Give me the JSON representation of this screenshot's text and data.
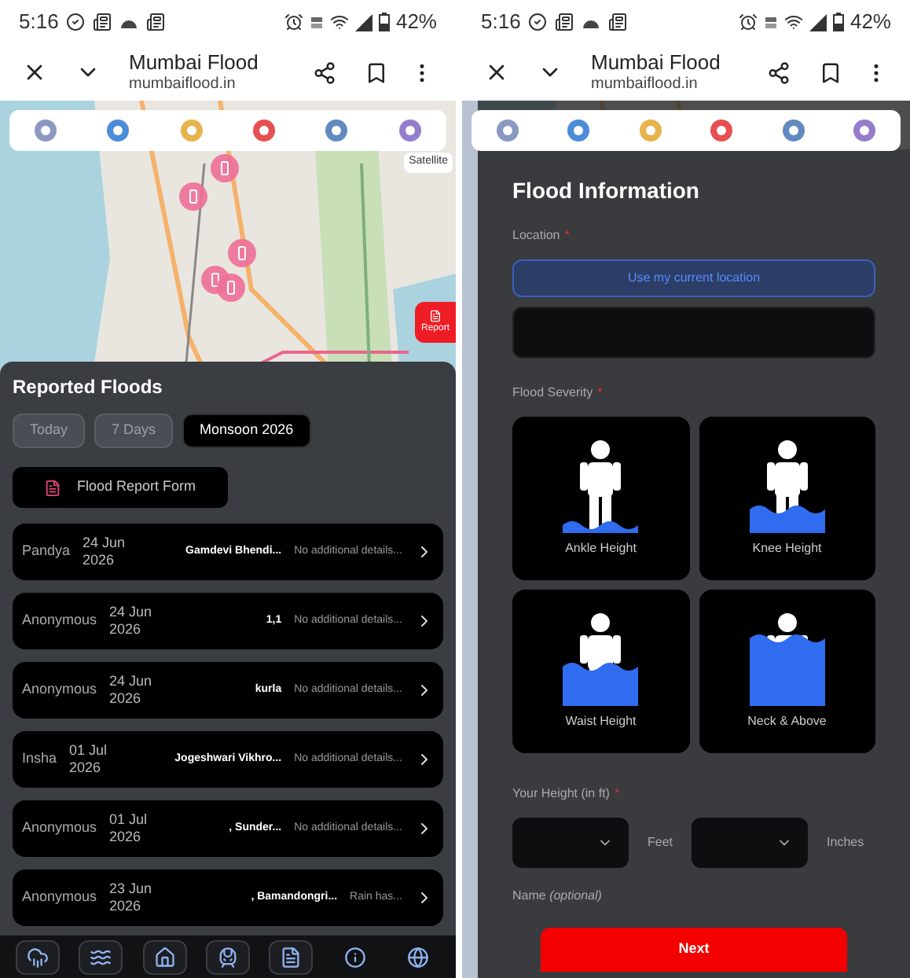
{
  "left_screen": {
    "status_bar": {
      "time": "5:16",
      "battery": "42%"
    },
    "browser_bar": {
      "title": "Mumbai Flood",
      "url": "mumbaiflood.in"
    },
    "map": {
      "satellite_button": "Satellite",
      "report_button": "Report"
    },
    "reported_floods": {
      "title": "Reported Floods",
      "tabs": [
        {
          "label": "Today",
          "selected": false
        },
        {
          "label": "7 Days",
          "selected": false
        },
        {
          "label": "Monsoon 2026",
          "selected": true
        }
      ],
      "form_button": "Flood Report Form",
      "reports": [
        {
          "name": "Pandya",
          "date": "24 Jun 2026",
          "location": "Gamdevi Bhendi...",
          "details": "No additional details..."
        },
        {
          "name": "Anonymous",
          "date": "24 Jun 2026",
          "location": "1,1",
          "details": "No additional details..."
        },
        {
          "name": "Anonymous",
          "date": "24 Jun 2026",
          "location": "kurla",
          "details": "No additional details..."
        },
        {
          "name": "Insha",
          "date": "01 Jul 2026",
          "location": "Jogeshwari Vikhro...",
          "details": "No additional details..."
        },
        {
          "name": "Anonymous",
          "date": "01 Jul 2026",
          "location": ", Sunder...",
          "details": "No additional details..."
        },
        {
          "name": "Anonymous",
          "date": "23 Jun 2026",
          "location": ", Bamandongri...",
          "details": "Rain has..."
        }
      ]
    },
    "bottom_nav": [
      {
        "kind": "rain",
        "boxed": true
      },
      {
        "kind": "waves",
        "boxed": true
      },
      {
        "kind": "house",
        "boxed": true
      },
      {
        "kind": "train",
        "boxed": true
      },
      {
        "kind": "document",
        "boxed": true
      },
      {
        "kind": "info",
        "boxed": false
      },
      {
        "kind": "globe",
        "boxed": false
      }
    ]
  },
  "right_screen": {
    "status_bar": {
      "time": "5:16",
      "battery": "42%"
    },
    "browser_bar": {
      "title": "Mumbai Flood",
      "url": "mumbaiflood.in"
    },
    "flood_form": {
      "title": "Flood Information",
      "location": {
        "label": "Location",
        "required_mark": "*",
        "button": "Use my current location"
      },
      "severity": {
        "label": "Flood Severity",
        "required_mark": "*",
        "options": [
          {
            "kind": "ankle",
            "label": "Ankle Height"
          },
          {
            "kind": "knee",
            "label": "Knee Height"
          },
          {
            "kind": "waist",
            "label": "Waist Height"
          },
          {
            "kind": "neck",
            "label": "Neck & Above"
          }
        ]
      },
      "height": {
        "label": "Your Height (in ft)",
        "required_mark": "*",
        "units": [
          "Feet",
          "Inches"
        ]
      },
      "name": {
        "label": "Name *(optional)*"
      },
      "next_button": "Next"
    }
  }
}
